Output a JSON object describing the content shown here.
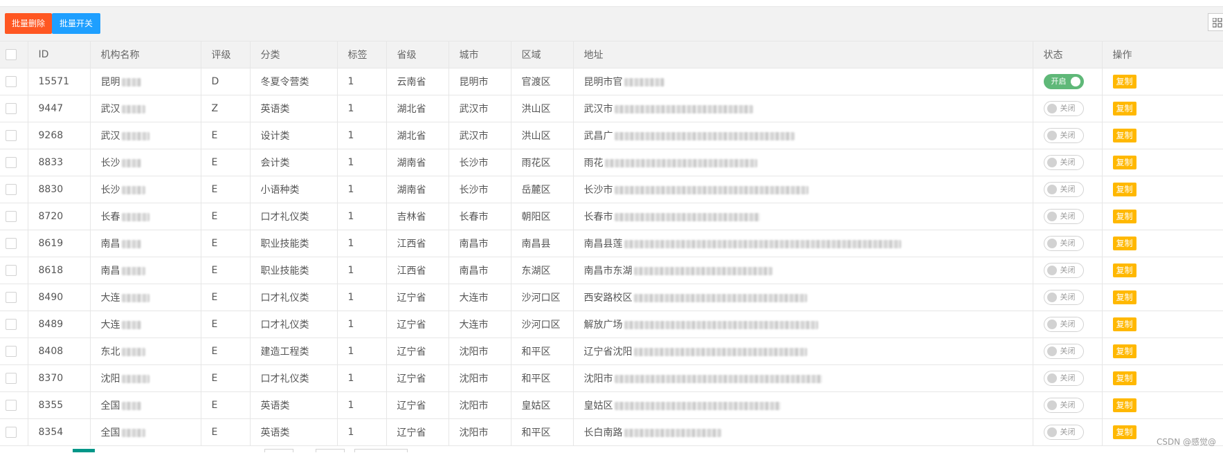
{
  "toolbar": {
    "batch_delete_label": "批量删除",
    "batch_switch_label": "批量开关"
  },
  "table": {
    "headers": [
      "ID",
      "机构名称",
      "评级",
      "分类",
      "标签",
      "省级",
      "城市",
      "区域",
      "地址",
      "状态",
      "操作"
    ],
    "rows": [
      {
        "id": "15571",
        "name": "昆明",
        "rating": "D",
        "category": "冬夏令营类",
        "tag": "1",
        "province": "云南省",
        "city": "昆明市",
        "district": "官渡区",
        "address": "昆明市官",
        "status": "开启",
        "status_on": true
      },
      {
        "id": "9447",
        "name": "武汉",
        "rating": "Z",
        "category": "英语类",
        "tag": "1",
        "province": "湖北省",
        "city": "武汉市",
        "district": "洪山区",
        "address": "武汉市",
        "status": "关闭",
        "status_on": false
      },
      {
        "id": "9268",
        "name": "武汉",
        "rating": "E",
        "category": "设计类",
        "tag": "1",
        "province": "湖北省",
        "city": "武汉市",
        "district": "洪山区",
        "address": "武昌广",
        "status": "关闭",
        "status_on": false
      },
      {
        "id": "8833",
        "name": "长沙",
        "rating": "E",
        "category": "会计类",
        "tag": "1",
        "province": "湖南省",
        "city": "长沙市",
        "district": "雨花区",
        "address": "雨花",
        "status": "关闭",
        "status_on": false
      },
      {
        "id": "8830",
        "name": "长沙",
        "rating": "E",
        "category": "小语种类",
        "tag": "1",
        "province": "湖南省",
        "city": "长沙市",
        "district": "岳麓区",
        "address": "长沙市",
        "status": "关闭",
        "status_on": false
      },
      {
        "id": "8720",
        "name": "长春",
        "rating": "E",
        "category": "口才礼仪类",
        "tag": "1",
        "province": "吉林省",
        "city": "长春市",
        "district": "朝阳区",
        "address": "长春市",
        "status": "关闭",
        "status_on": false
      },
      {
        "id": "8619",
        "name": "南昌",
        "rating": "E",
        "category": "职业技能类",
        "tag": "1",
        "province": "江西省",
        "city": "南昌市",
        "district": "南昌县",
        "address": "南昌县莲",
        "status": "关闭",
        "status_on": false
      },
      {
        "id": "8618",
        "name": "南昌",
        "rating": "E",
        "category": "职业技能类",
        "tag": "1",
        "province": "江西省",
        "city": "南昌市",
        "district": "东湖区",
        "address": "南昌市东湖",
        "status": "关闭",
        "status_on": false
      },
      {
        "id": "8490",
        "name": "大连",
        "rating": "E",
        "category": "口才礼仪类",
        "tag": "1",
        "province": "辽宁省",
        "city": "大连市",
        "district": "沙河口区",
        "address": "西安路校区",
        "status": "关闭",
        "status_on": false
      },
      {
        "id": "8489",
        "name": "大连",
        "rating": "E",
        "category": "口才礼仪类",
        "tag": "1",
        "province": "辽宁省",
        "city": "大连市",
        "district": "沙河口区",
        "address": "解放广场",
        "status": "关闭",
        "status_on": false
      },
      {
        "id": "8408",
        "name": "东北",
        "rating": "E",
        "category": "建造工程类",
        "tag": "1",
        "province": "辽宁省",
        "city": "沈阳市",
        "district": "和平区",
        "address": "辽宁省沈阳",
        "status": "关闭",
        "status_on": false
      },
      {
        "id": "8370",
        "name": "沈阳",
        "rating": "E",
        "category": "口才礼仪类",
        "tag": "1",
        "province": "辽宁省",
        "city": "沈阳市",
        "district": "和平区",
        "address": "沈阳市",
        "status": "关闭",
        "status_on": false
      },
      {
        "id": "8355",
        "name": "全国",
        "rating": "E",
        "category": "英语类",
        "tag": "1",
        "province": "辽宁省",
        "city": "沈阳市",
        "district": "皇姑区",
        "address": "皇姑区",
        "status": "关闭",
        "status_on": false
      },
      {
        "id": "8354",
        "name": "全国",
        "rating": "E",
        "category": "英语类",
        "tag": "1",
        "province": "辽宁省",
        "city": "沈阳市",
        "district": "和平区",
        "address": "长白南路",
        "status": "关闭",
        "status_on": false
      }
    ],
    "action_label": "复制"
  },
  "watermark": "CSDN @感觉@",
  "colors": {
    "danger": "#ff5722",
    "normal": "#1e9fff",
    "switch_on": "#5fb878",
    "warm": "#ffb800"
  },
  "icons": {
    "toolbar_right": "columns-icon"
  }
}
